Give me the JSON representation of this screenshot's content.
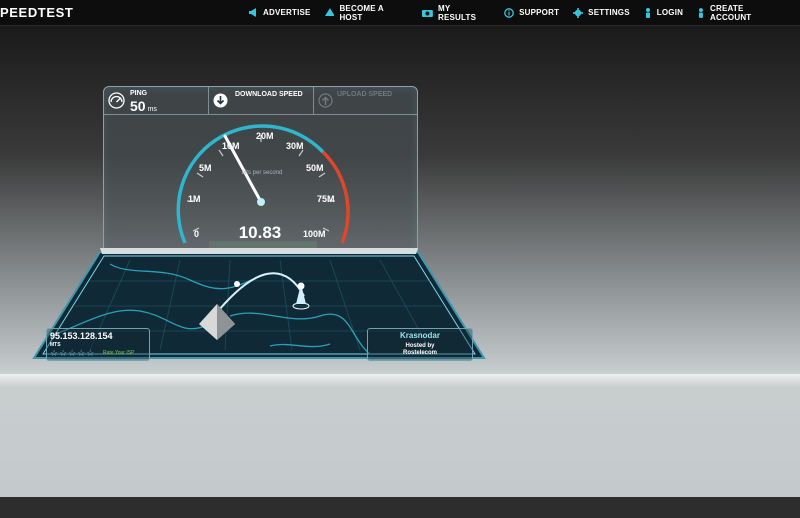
{
  "header": {
    "logo": "PEEDTEST",
    "nav": [
      {
        "label": "ADVERTISE",
        "icon": "megaphone-icon"
      },
      {
        "label": "BECOME A HOST",
        "icon": "host-pyramid-icon"
      },
      {
        "label": "MY RESULTS",
        "icon": "results-camera-icon"
      },
      {
        "label": "SUPPORT",
        "icon": "info-icon"
      },
      {
        "label": "SETTINGS",
        "icon": "gear-icon"
      },
      {
        "label": "LOGIN",
        "icon": "person-icon"
      },
      {
        "label": "CREATE ACCOUNT",
        "icon": "person-add-icon"
      }
    ]
  },
  "test": {
    "ping": {
      "label": "PING",
      "value": "50",
      "unit": "ms"
    },
    "download": {
      "label": "DOWNLOAD SPEED"
    },
    "upload": {
      "label": "UPLOAD SPEED"
    },
    "gauge": {
      "ticks": [
        "0",
        "1M",
        "5M",
        "10M",
        "20M",
        "30M",
        "50M",
        "75M",
        "100M"
      ],
      "caption": "bits per second",
      "current_speed": "10.83"
    }
  },
  "client": {
    "ip": "95.153.128.154",
    "isp": "MTS",
    "rating_stars": 5,
    "rate_label": "Rate Your ISP"
  },
  "server": {
    "city": "Krasnodar",
    "hosted_label": "Hosted by",
    "host": "Rostelecom"
  },
  "colors": {
    "accent": "#36c6e0",
    "hot": "#e0472a",
    "topbar": "#0d0d0d"
  }
}
